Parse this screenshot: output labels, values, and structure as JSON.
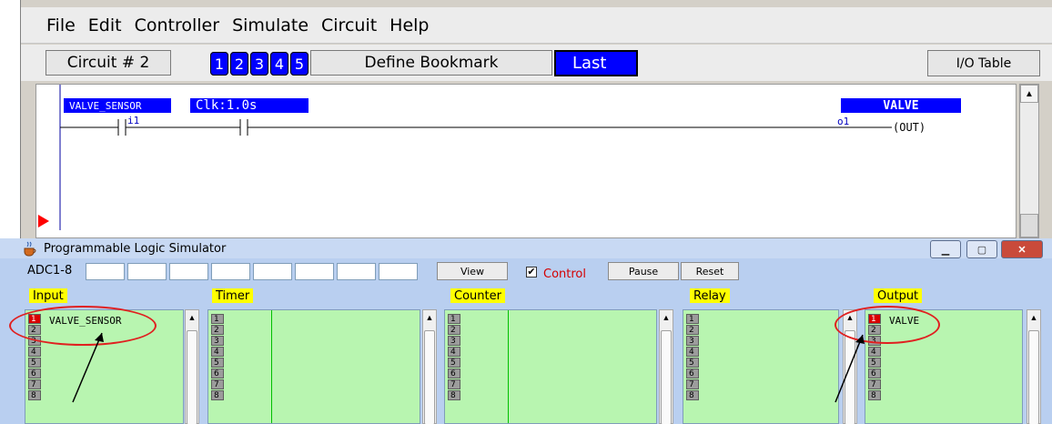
{
  "menubar": {
    "items": [
      "File",
      "Edit",
      "Controller",
      "Simulate",
      "Circuit",
      "Help"
    ]
  },
  "toolbar": {
    "circuit": "Circuit # 2",
    "bookmarks": [
      "1",
      "2",
      "3",
      "4",
      "5"
    ],
    "define_bookmark": "Define Bookmark",
    "last": "Last",
    "io_table": "I/O Table"
  },
  "ladder": {
    "contact1_label": "VALVE_SENSOR",
    "contact1_addr": "i1",
    "contact2_label": "Clk:1.0s",
    "coil_label": "VALVE",
    "coil_addr": "o1",
    "coil_type": "(OUT)"
  },
  "simulator": {
    "title": "Programmable Logic Simulator",
    "adc_label": "ADC1-8",
    "view": "View",
    "control": "Control",
    "control_checked": "✔",
    "pause": "Pause",
    "reset": "Reset",
    "sections": {
      "input": "Input",
      "timer": "Timer",
      "counter": "Counter",
      "relay": "Relay",
      "output": "Output"
    },
    "slots": [
      "1",
      "2",
      "3",
      "4",
      "5",
      "6",
      "7",
      "8"
    ],
    "input_1": "VALVE_SENSOR",
    "output_1": "VALVE"
  },
  "colors": {
    "accent_blue": "#0000ff",
    "panel_green": "#b8f5b0",
    "header_yellow": "#ffff00",
    "highlight_red": "#e02020"
  }
}
